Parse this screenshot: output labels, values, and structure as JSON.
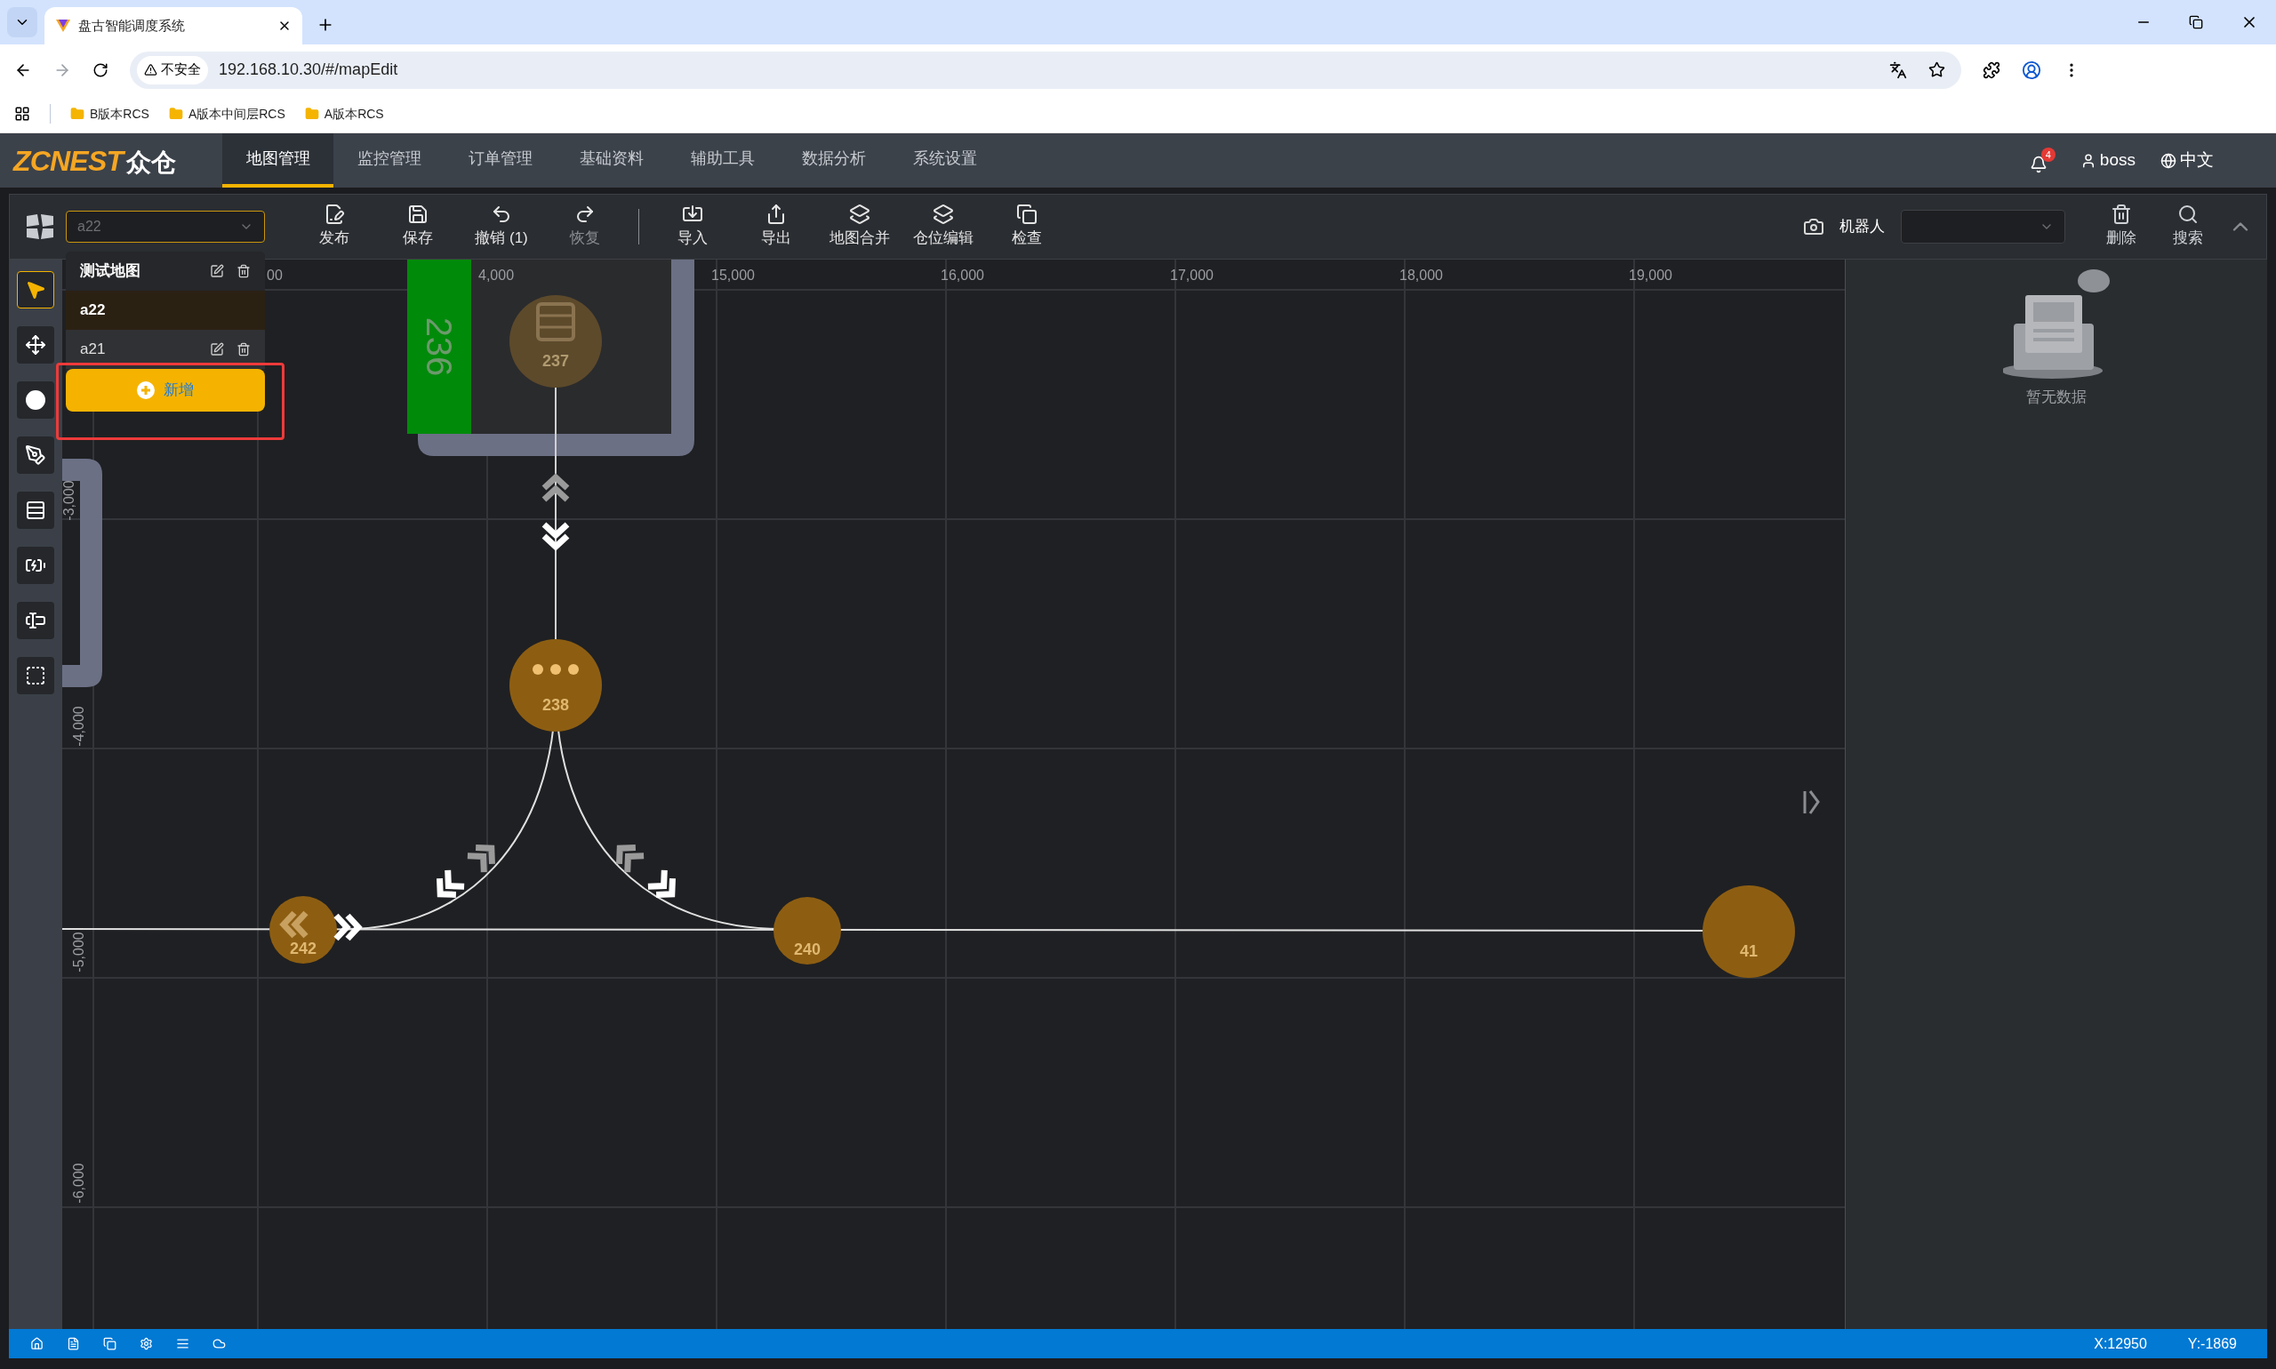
{
  "browser": {
    "tab_title": "盘古智能调度系统",
    "security_label": "不安全",
    "url": "192.168.10.30/#/mapEdit",
    "bookmarks": [
      "B版本RCS",
      "A版本中间层RCS",
      "A版本RCS"
    ]
  },
  "nav": {
    "logo": {
      "brand": "ZCNEST",
      "name": "众仓"
    },
    "tabs": [
      {
        "label": "地图管理",
        "selected": true
      },
      {
        "label": "监控管理",
        "selected": false
      },
      {
        "label": "订单管理",
        "selected": false
      },
      {
        "label": "基础资料",
        "selected": false
      },
      {
        "label": "辅助工具",
        "selected": false
      },
      {
        "label": "数据分析",
        "selected": false
      },
      {
        "label": "系统设置",
        "selected": false
      }
    ],
    "notification_count": "4",
    "user": "boss",
    "language": "中文"
  },
  "toolbar": {
    "map_select": "a22",
    "actions": [
      {
        "kind": "publish",
        "label": "发布",
        "disabled": false
      },
      {
        "kind": "save",
        "label": "保存",
        "disabled": false
      },
      {
        "kind": "undo",
        "label": "撤销 (1)",
        "disabled": false
      },
      {
        "kind": "redo",
        "label": "恢复",
        "disabled": true
      },
      {
        "kind": "import",
        "label": "导入",
        "disabled": false
      },
      {
        "kind": "export",
        "label": "导出",
        "disabled": false
      },
      {
        "kind": "merge",
        "label": "地图合并",
        "disabled": false
      },
      {
        "kind": "slot",
        "label": "仓位编辑",
        "disabled": false
      },
      {
        "kind": "check",
        "label": "检查",
        "disabled": false
      }
    ],
    "robot_label": "机器人",
    "right_actions": [
      {
        "kind": "delete",
        "label": "删除"
      },
      {
        "kind": "search",
        "label": "搜索"
      }
    ]
  },
  "map_menu": {
    "items": [
      {
        "label": "测试地图",
        "selected": false
      },
      {
        "label": "a22",
        "selected": true
      },
      {
        "label": "a21",
        "selected": false
      }
    ],
    "add_button": "新增"
  },
  "tools": [
    {
      "kind": "select",
      "selected": true
    },
    {
      "kind": "move",
      "selected": false
    },
    {
      "kind": "point",
      "selected": false
    },
    {
      "kind": "pen",
      "selected": false
    },
    {
      "kind": "shelf",
      "selected": false
    },
    {
      "kind": "charger",
      "selected": false
    },
    {
      "kind": "text",
      "selected": false
    },
    {
      "kind": "area",
      "selected": false
    }
  ],
  "map": {
    "x_ticks": [
      "00",
      "4,000",
      "15,000",
      "16,000",
      "17,000",
      "18,000",
      "19,000"
    ],
    "y_ticks": [
      "-3,000",
      "-4,000",
      "-5,000",
      "-6,000"
    ],
    "area_label": "236",
    "nodes": [
      {
        "label": "237",
        "kind": "storage"
      },
      {
        "label": "238",
        "kind": "waiting"
      },
      {
        "label": "242",
        "kind": "point"
      },
      {
        "label": "240",
        "kind": "point"
      },
      {
        "label": "41",
        "kind": "point"
      }
    ]
  },
  "right_panel": {
    "empty_text": "暂无数据"
  },
  "status_bar": {
    "x": "X:12950",
    "y": "Y:-1869"
  }
}
